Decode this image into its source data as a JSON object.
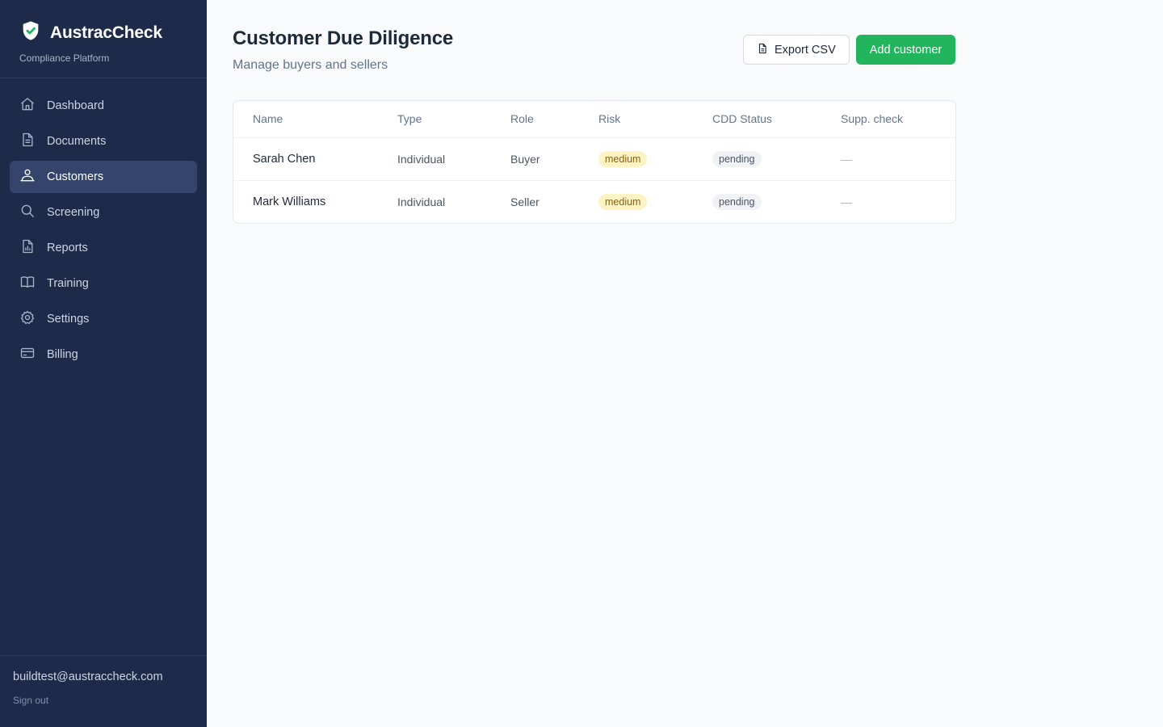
{
  "brand": {
    "name": "AustracCheck",
    "subtitle": "Compliance Platform",
    "accent": "#22b55e"
  },
  "nav": [
    {
      "label": "Dashboard",
      "icon": "home-icon",
      "active": false
    },
    {
      "label": "Documents",
      "icon": "document-icon",
      "active": false
    },
    {
      "label": "Customers",
      "icon": "customers-icon",
      "active": true
    },
    {
      "label": "Screening",
      "icon": "search-icon",
      "active": false
    },
    {
      "label": "Reports",
      "icon": "report-icon",
      "active": false
    },
    {
      "label": "Training",
      "icon": "book-icon",
      "active": false
    },
    {
      "label": "Settings",
      "icon": "gear-icon",
      "active": false
    },
    {
      "label": "Billing",
      "icon": "credit-card-icon",
      "active": false
    }
  ],
  "user": {
    "email": "buildtest@austraccheck.com",
    "signout_label": "Sign out"
  },
  "page": {
    "title": "Customer Due Diligence",
    "subtitle": "Manage buyers and sellers"
  },
  "actions": {
    "export_label": "Export CSV",
    "add_label": "Add customer"
  },
  "table": {
    "headers": [
      "Name",
      "Type",
      "Role",
      "Risk",
      "CDD Status",
      "Supp. check"
    ],
    "rows": [
      {
        "name": "Sarah Chen",
        "type": "Individual",
        "role": "Buyer",
        "risk": "medium",
        "status": "pending",
        "supp": "—"
      },
      {
        "name": "Mark Williams",
        "type": "Individual",
        "role": "Seller",
        "risk": "medium",
        "status": "pending",
        "supp": "—"
      }
    ]
  }
}
